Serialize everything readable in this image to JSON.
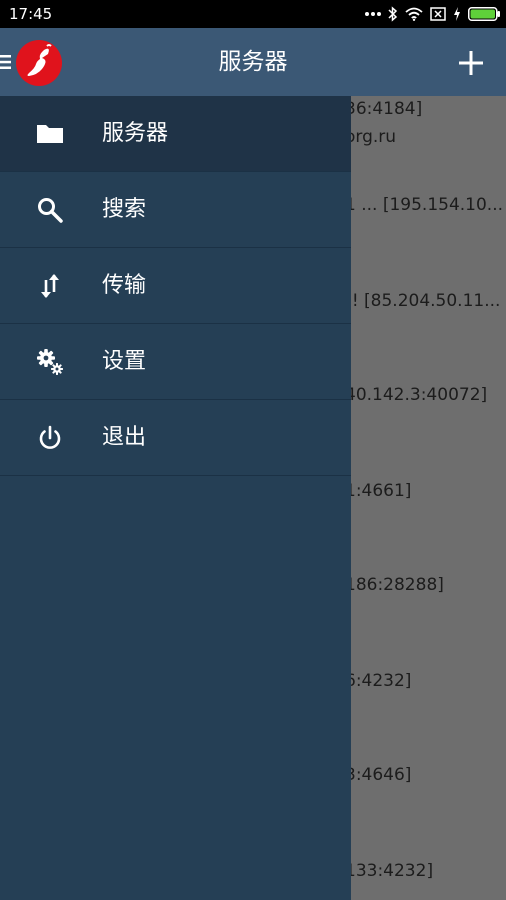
{
  "status_bar": {
    "time": "17:45",
    "icons": [
      "more-dots-icon",
      "bluetooth-icon",
      "wifi-icon",
      "no-sim-icon",
      "charging-icon",
      "battery-icon"
    ],
    "battery_color": "#5fd13a"
  },
  "app_bar": {
    "title": "服务器",
    "background_color": "#3b5875",
    "logo_color": "#e0131c",
    "icons": [
      "menu-icon",
      "app-logo-icon",
      "plus-icon"
    ]
  },
  "drawer": {
    "background_color": "#253f55",
    "active_color": "#1f3347",
    "items": [
      {
        "label": "服务器",
        "icon": "folder-icon",
        "active": true
      },
      {
        "label": "搜索",
        "icon": "search-icon",
        "active": false
      },
      {
        "label": "传输",
        "icon": "transfer-arrows-icon",
        "active": false
      },
      {
        "label": "设置",
        "icon": "gears-icon",
        "active": false
      },
      {
        "label": "退出",
        "icon": "power-icon",
        "active": false
      }
    ]
  },
  "background_list": {
    "overlay_color": "#6e6e6e",
    "entries": [
      "36:4184]",
      "org.ru",
      "1 ... [195.154.10...",
      "!! [85.204.50.11...",
      "40.142.3:40072]",
      "1:4661]",
      "186:28288]",
      "6:4232]",
      "3:4646]",
      "133:4232]"
    ]
  }
}
